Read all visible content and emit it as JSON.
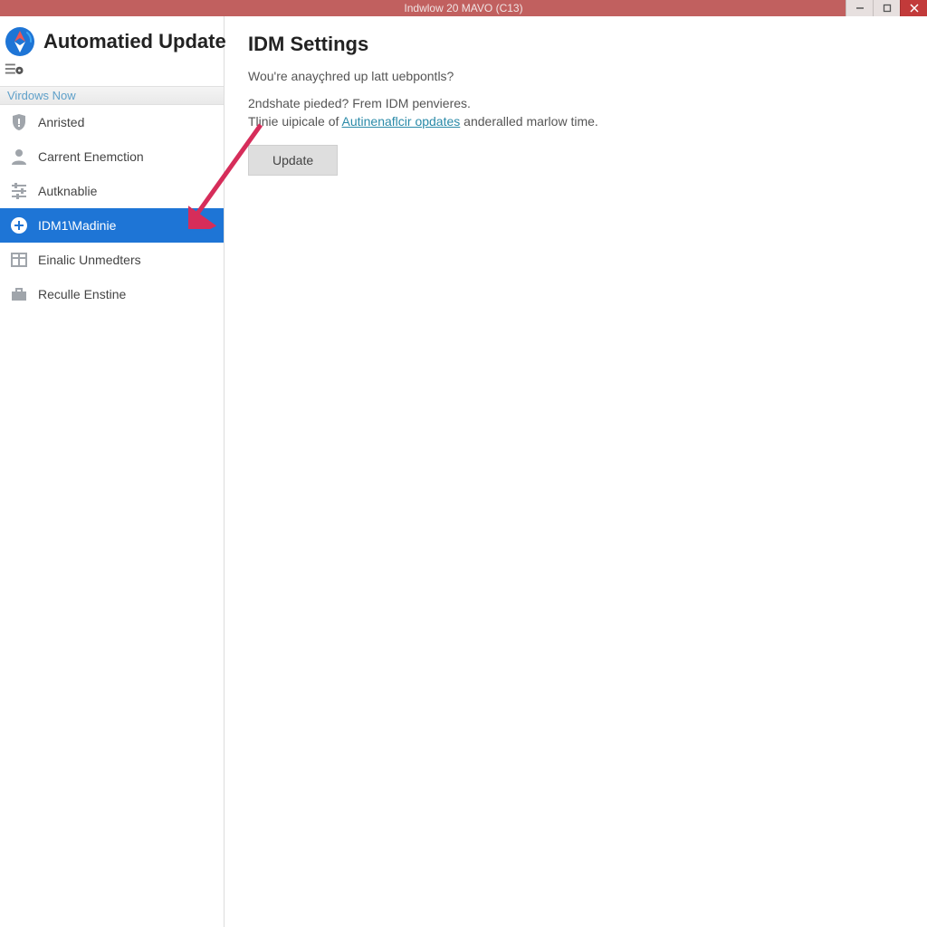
{
  "titlebar": {
    "title": "Indwlow 20 MAVO (C13)"
  },
  "sidebar": {
    "title": "Automatied Update",
    "subheader": "Virdows Now",
    "items": [
      {
        "label": "Anristed",
        "icon": "shield",
        "selected": false
      },
      {
        "label": "Carrent Enemction",
        "icon": "user",
        "selected": false
      },
      {
        "label": "Autknablie",
        "icon": "sliders",
        "selected": false
      },
      {
        "label": "IDM1\\Madinie",
        "icon": "plus",
        "selected": true
      },
      {
        "label": "Einalic Unmedters",
        "icon": "grid",
        "selected": false
      },
      {
        "label": "Reculle Enstine",
        "icon": "briefcase",
        "selected": false
      }
    ]
  },
  "main": {
    "heading": "IDM Settings",
    "para1": "Wou're anayçhred up latt uebpontls?",
    "para2": "2ndshate pieded? Frem IDM penvieres.",
    "para3_pre": "Tlinie uipicale of ",
    "para3_link": "Autinenaflcir opdates",
    "para3_post": " anderalled marlow time.",
    "button": "Update"
  }
}
